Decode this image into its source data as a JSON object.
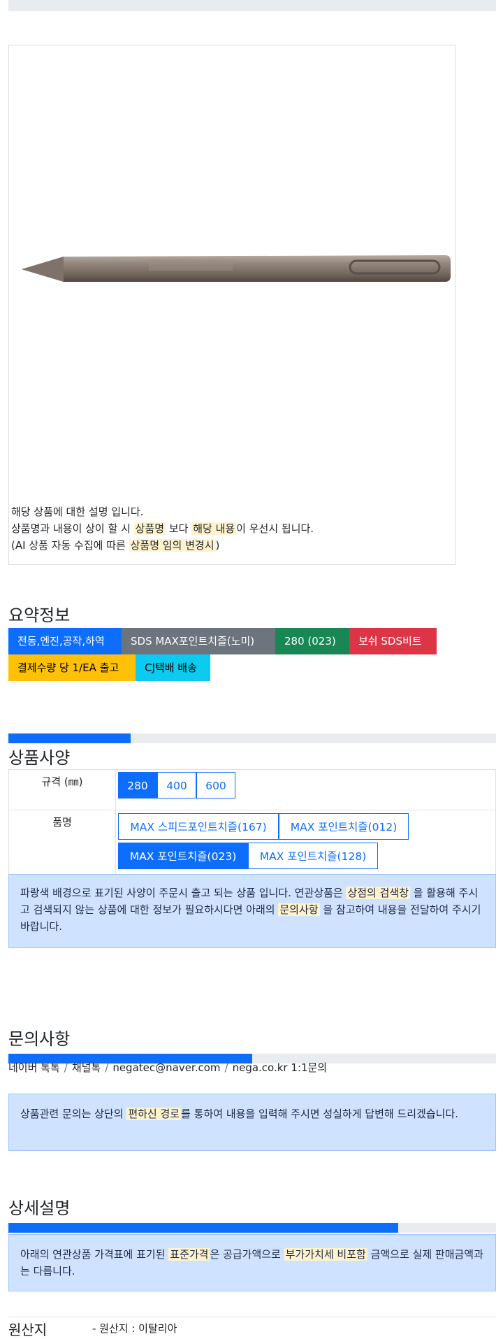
{
  "product": {
    "description": {
      "line1": "해당 상품에 대한 설명 입니다.",
      "line2_pre": "상품명과 내용이 상이 할 시 ",
      "line2_hl1": "상품명",
      "line2_mid": " 보다 ",
      "line2_hl2": "해당 내용",
      "line2_post": "이 우선시 됩니다.",
      "line3_pre": "(AI 상품 자동 수집에 따른 ",
      "line3_hl": "상품명 임의 변경시",
      "line3_post": ")"
    }
  },
  "summary": {
    "title": "요약정보",
    "badges": [
      {
        "label": "전동,엔진,공작,하역",
        "color": "#0d6efd"
      },
      {
        "label": "SDS MAX포인트치즐(노미)",
        "color": "#6c757d"
      },
      {
        "label": "280 (023)",
        "color": "#198754"
      },
      {
        "label": "보쉬 SDS비트",
        "color": "#dc3545"
      },
      {
        "label": "결제수량 당 1/EA 출고",
        "color": "#ffc107"
      },
      {
        "label": "CJ택배 배송",
        "color": "#0dcaf0"
      }
    ]
  },
  "specs": {
    "title": "상품사양",
    "progress": 0.25,
    "rows": [
      {
        "label": "규격 (㎜)",
        "options": [
          "280",
          "400",
          "600"
        ],
        "selected": "280"
      },
      {
        "label": "품명",
        "options": [
          "MAX 스피드포인트치즐(167)",
          "MAX 포인트치즐(012)",
          "MAX 포인트치즐(023)",
          "MAX 포인트치즐(128)"
        ],
        "selected": "MAX 포인트치즐(023)"
      }
    ],
    "notice": {
      "pre": "파랑색 배경으로 표기된 사양이 주문시 출고 되는 상품 입니다. 연관상품은 ",
      "hl1": "상점의 검색창",
      "mid": " 을 활용해 주시고 검색되지 않는 상품에 대한 정보가 필요하시다면 아래의 ",
      "hl2": "문의사항",
      "post": " 을 참고하여 내용을 전달하여 주시기 바랍니다."
    }
  },
  "inquiry": {
    "title": "문의사항",
    "progress": 0.5,
    "contacts": [
      "네이버 톡톡",
      "채널톡",
      "negatec@naver.com",
      "nega.co.kr 1:1문의"
    ],
    "notice": {
      "pre": "상품관련 문의는 상단의 ",
      "hl": "편하신 경로",
      "post": "를 통하여 내용을 입력해 주시면 성실하게 답변해 드리겠습니다."
    }
  },
  "detail": {
    "title": "상세설명",
    "progress": 0.8,
    "notice": {
      "pre": "아래의 연관상품 가격표에 표기된 ",
      "hl1": "표준가격",
      "mid": "은 공급가액으로 ",
      "hl2": "부가가치세 비포함",
      "post": " 금액으로 실제 판매금액과는 다릅니다."
    }
  },
  "origin": {
    "label": "원산지",
    "value": "- 원산지 : 이탈리아"
  }
}
